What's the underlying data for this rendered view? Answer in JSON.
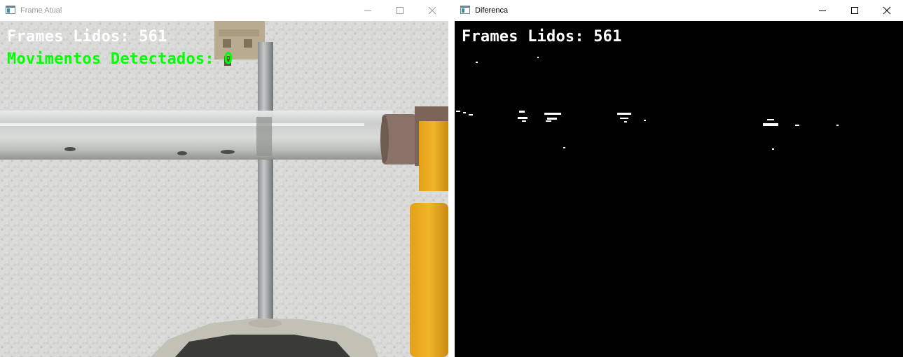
{
  "windows": [
    {
      "title": "Frame Atual",
      "frames_label": "Frames Lidos: 561",
      "movements_label": "Movimentos Detectados: 0",
      "text_colors": {
        "frames": "#ffffff",
        "movements": "#00ff00"
      }
    },
    {
      "title": "Diferenca",
      "frames_label": "Frames Lidos: 561",
      "text_colors": {
        "frames": "#ffffff"
      },
      "background": "#000000"
    }
  ],
  "title_controls": [
    "minimize-icon",
    "maximize-icon",
    "close-icon"
  ]
}
